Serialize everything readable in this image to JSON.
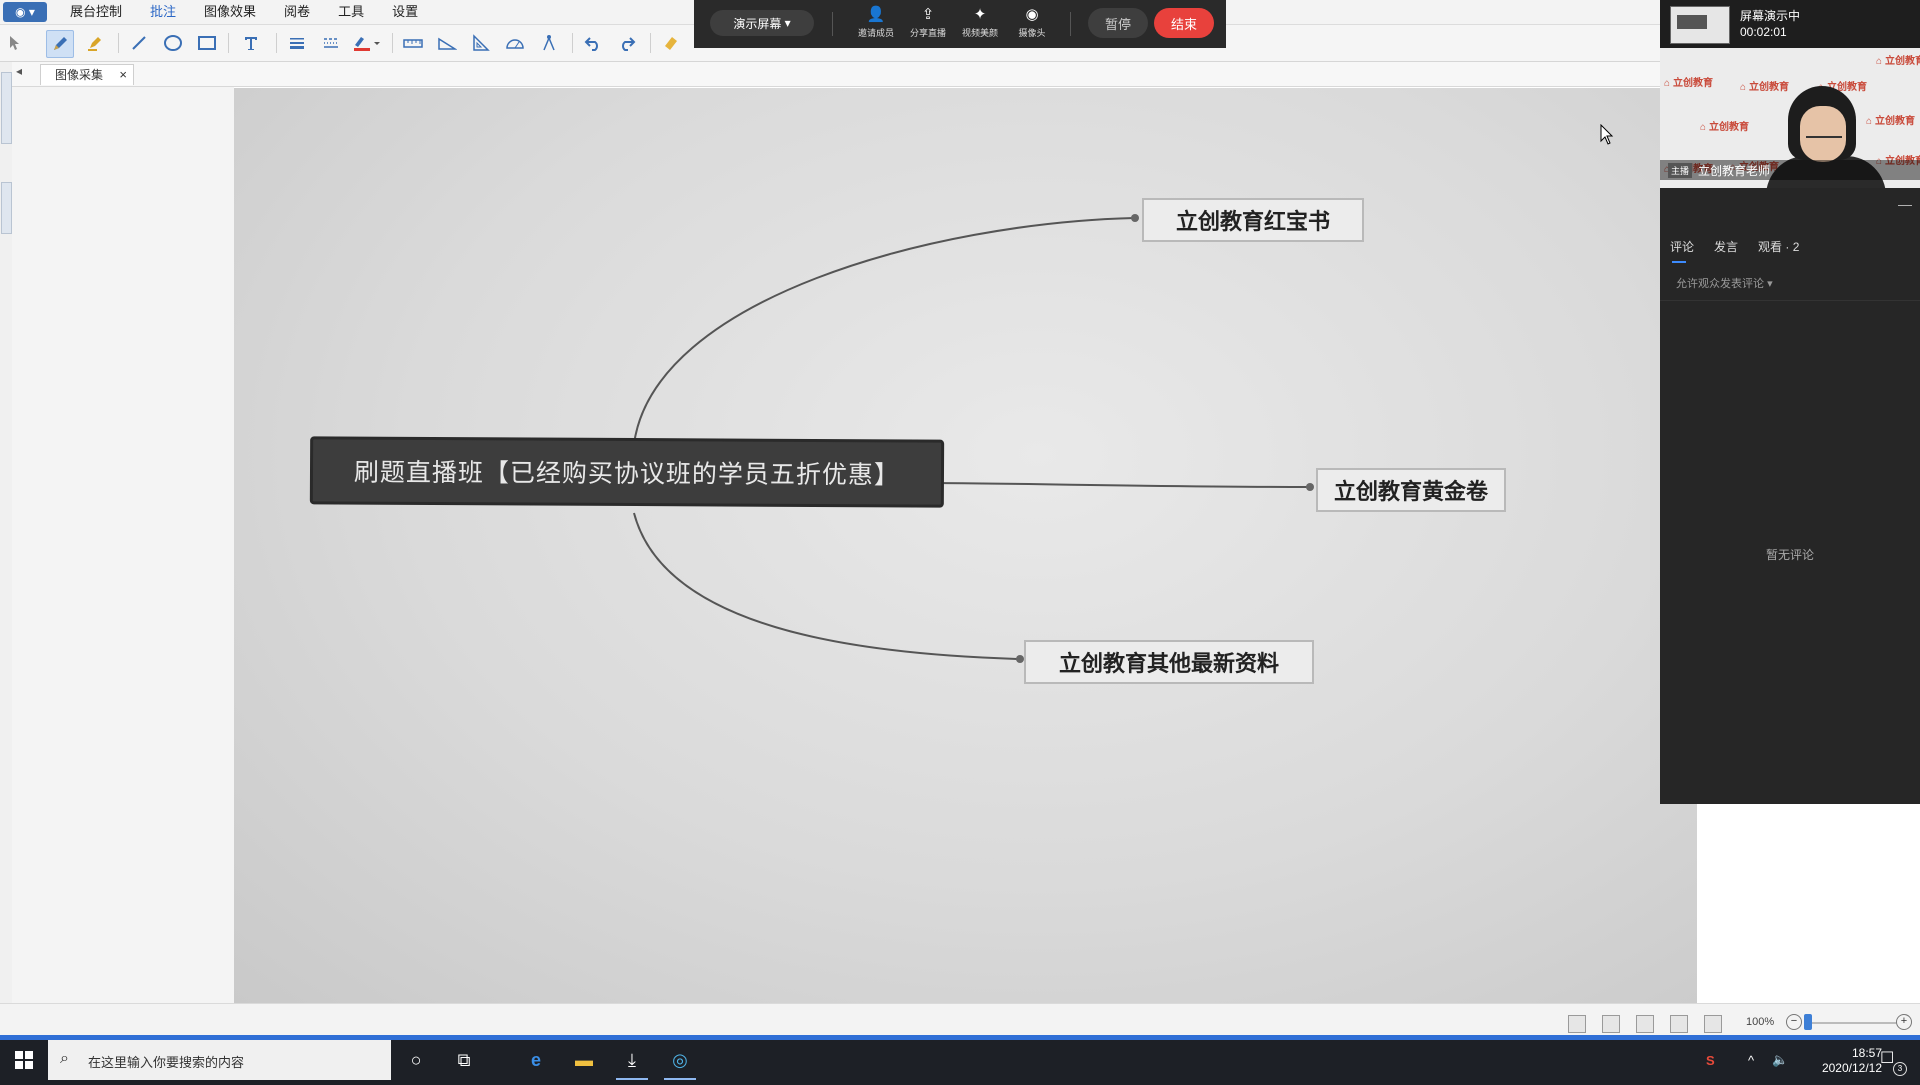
{
  "app": {
    "menu": [
      "展台控制",
      "批注",
      "图像效果",
      "阅卷",
      "工具",
      "设置"
    ],
    "active_menu": "批注"
  },
  "presenter_bar": {
    "mode": "演示屏幕",
    "buttons": [
      "邀请成员",
      "分享直播",
      "视频美颜",
      "摄像头"
    ],
    "pause": "暂停",
    "end": "结束"
  },
  "document": {
    "tab": "图像采集",
    "close": "×"
  },
  "mindmap": {
    "center": "刷题直播班【已经购买协议班的学员五折优惠】",
    "branches": [
      "立创教育红宝书",
      "立创教育黄金卷",
      "立创教育其他最新资料"
    ]
  },
  "live_panel": {
    "status": "屏幕演示中",
    "timer": "00:02:01",
    "watermark": "立创教育",
    "host_tag": "主播",
    "host_name": "立创教育老师",
    "tabs": [
      "评论",
      "发言",
      "观看 · 2"
    ],
    "allow_comments": "允许观众发表评论",
    "empty": "暂无评论",
    "minimize": "—"
  },
  "statusbar": {
    "zoom": "100%"
  },
  "taskbar": {
    "search_placeholder": "在这里输入你要搜索的内容",
    "time": "18:57",
    "date": "2020/12/12",
    "notification_count": "3"
  },
  "colors": {
    "accent": "#2b67c6",
    "end_button": "#e8413c",
    "taskbar": "#1d2026",
    "brand_red": "#c94a3a"
  }
}
